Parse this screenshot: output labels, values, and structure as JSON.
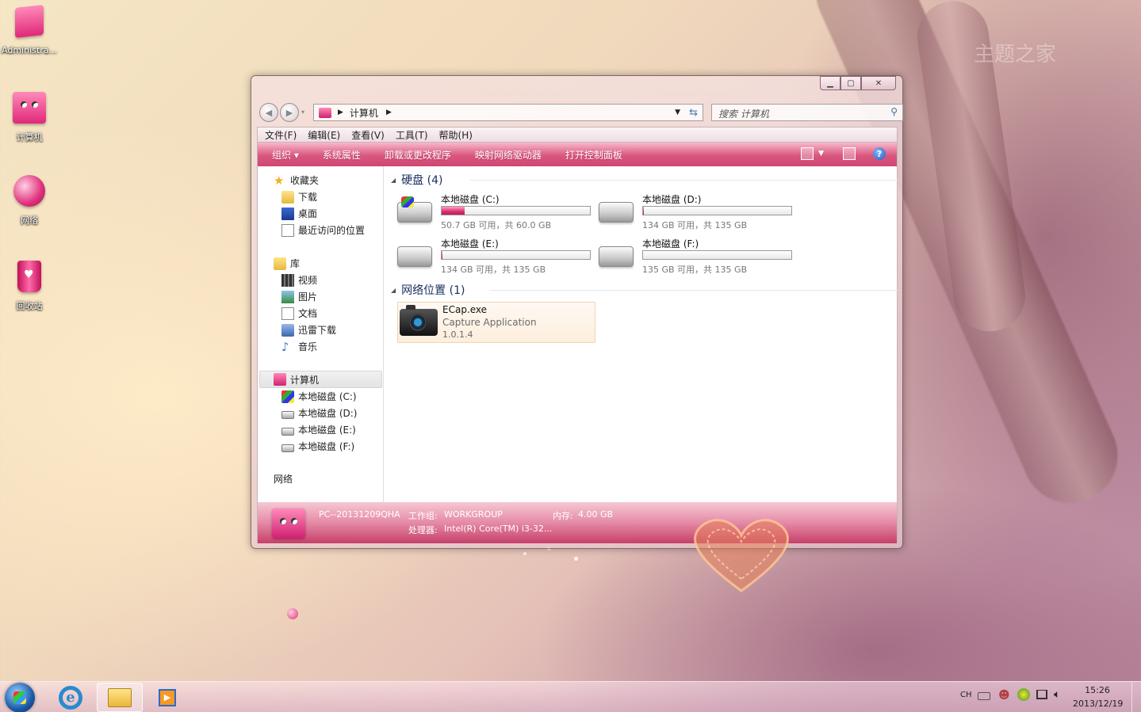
{
  "desktop": {
    "icons": [
      {
        "label": "Administra..."
      },
      {
        "label": "计算机"
      },
      {
        "label": "网络"
      },
      {
        "label": "回收站"
      }
    ],
    "watermark": "主题之家"
  },
  "window": {
    "address": {
      "path": "计算机"
    },
    "search": {
      "placeholder": "搜索 计算机"
    },
    "menu": [
      "文件(F)",
      "编辑(E)",
      "查看(V)",
      "工具(T)",
      "帮助(H)"
    ],
    "toolbar": [
      "组织 ▾",
      "系统属性",
      "卸载或更改程序",
      "映射网络驱动器",
      "打开控制面板"
    ],
    "nav": {
      "favorites": {
        "label": "收藏夹",
        "items": [
          "下载",
          "桌面",
          "最近访问的位置"
        ]
      },
      "libraries": {
        "label": "库",
        "items": [
          "视频",
          "图片",
          "文档",
          "迅雷下载",
          "音乐"
        ]
      },
      "computer": {
        "label": "计算机",
        "items": [
          "本地磁盘 (C:)",
          "本地磁盘 (D:)",
          "本地磁盘 (E:)",
          "本地磁盘 (F:)"
        ]
      },
      "network": {
        "label": "网络"
      }
    },
    "groups": {
      "drives_header": "硬盘 (4)",
      "network_header": "网络位置 (1)"
    },
    "drives": [
      {
        "name": "本地磁盘 (C:)",
        "size": "50.7 GB 可用，共 60.0 GB",
        "used_fraction": 0.155
      },
      {
        "name": "本地磁盘 (D:)",
        "size": "134 GB 可用，共 135 GB",
        "used_fraction": 0.007
      },
      {
        "name": "本地磁盘 (E:)",
        "size": "134 GB 可用，共 135 GB",
        "used_fraction": 0.007
      },
      {
        "name": "本地磁盘 (F:)",
        "size": "135 GB 可用，共 135 GB",
        "used_fraction": 0.0
      }
    ],
    "network_item": {
      "name": "ECap.exe",
      "desc": "Capture Application",
      "version": "1.0.1.4"
    },
    "details": {
      "pc": "PC--20131209QHA",
      "workgroup_label": "工作组:",
      "workgroup": "WORKGROUP",
      "memory_label": "内存:",
      "memory": "4.00 GB",
      "cpu_label": "处理器:",
      "cpu": "Intel(R) Core(TM) i3-32..."
    }
  },
  "taskbar": {
    "tray": {
      "lang": "CH",
      "time": "15:26",
      "date": "2013/12/19"
    }
  }
}
